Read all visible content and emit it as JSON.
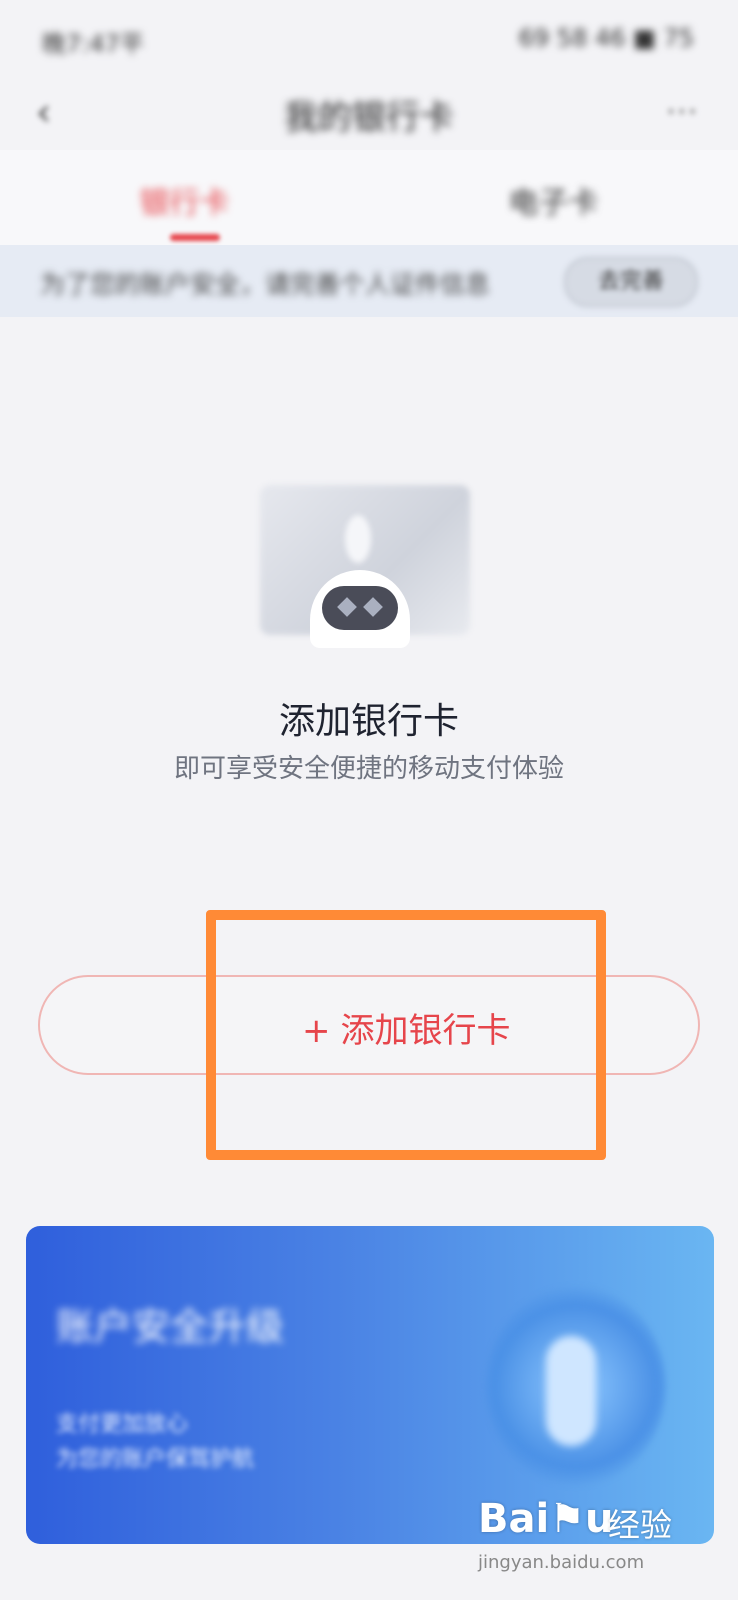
{
  "status_bar": {
    "left": "晚7:47平",
    "right": "69 58 46 ■ 75"
  },
  "header": {
    "title": "我的银行卡"
  },
  "tabs": [
    {
      "label": "银行卡"
    },
    {
      "label": "电子卡"
    }
  ],
  "notice": {
    "text": "为了您的账户安全，请完善个人证件信息",
    "button": "去完善"
  },
  "empty_state": {
    "title": "添加银行卡",
    "subtitle": "即可享受安全便捷的移动支付体验"
  },
  "add_button": {
    "plus": "+",
    "label": "添加银行卡"
  },
  "banner": {
    "title": "账户安全升级",
    "line1": "支付更加放心",
    "line2": "为您的账户保驾护航"
  },
  "watermark": {
    "logo": "Bai⚑u",
    "brand": "经验",
    "url": "jingyan.baidu.com"
  },
  "colors": {
    "accent": "#e6454b",
    "highlight": "#ff8a36",
    "banner_start": "#2f5fdc",
    "banner_end": "#6ab6f2"
  }
}
